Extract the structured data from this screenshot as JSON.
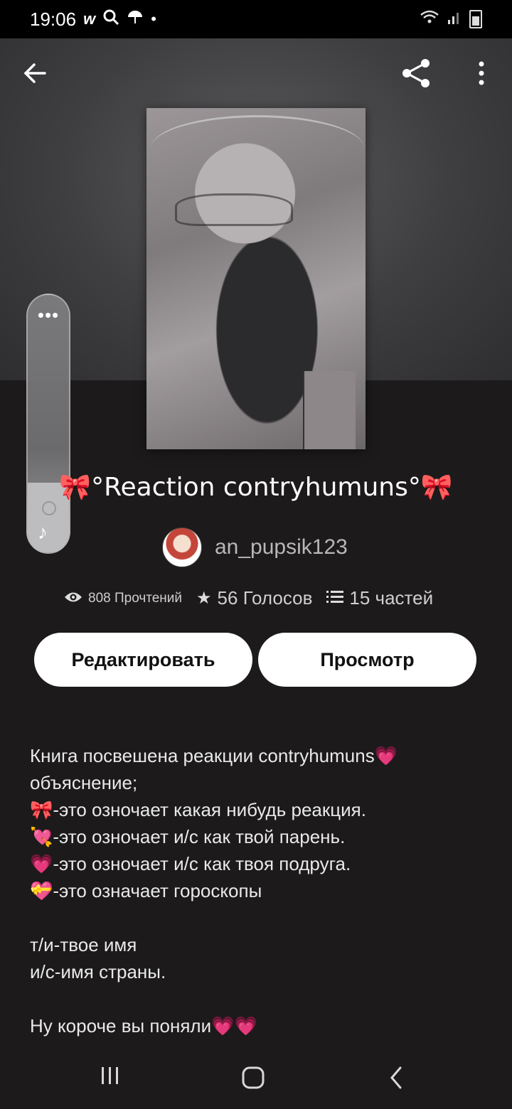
{
  "status_bar": {
    "time": "19:06",
    "icons": [
      "w-icon",
      "search-icon",
      "umbrella-icon",
      "dot-icon",
      "wifi-icon",
      "signal-icon",
      "battery-icon"
    ]
  },
  "top_bar": {
    "back_icon": "arrow-left-icon",
    "share_icon": "share-icon",
    "more_icon": "vertical-dots-icon"
  },
  "volume_panel": {
    "dots": "•••",
    "level": 0.27,
    "icon": "music-note-icon"
  },
  "story": {
    "title": "🎀°Reaction contryhumuns°🎀",
    "author": "an_pupsik123",
    "reads": "808 Прочтений",
    "votes": "56 Голосов",
    "parts": "15 частей"
  },
  "actions": {
    "edit_label": "Редактировать",
    "view_label": "Просмотр"
  },
  "description": {
    "lines": [
      "Книга посвешена реакции contryhumuns💗",
      "объяснение;",
      "🎀-это озночает какая нибудь реакция.",
      "💘-это озночает и/с как твой парень.",
      "💗-это озночает и/с как твоя подруга.",
      "💝-это означает гороскопы",
      "",
      "т/и-твое имя",
      "и/с-имя страны.",
      "",
      "Ну короче вы поняли💗💗"
    ]
  },
  "nav_bar": {
    "recent_icon": "recent-apps-icon",
    "home_icon": "home-icon",
    "back_icon": "back-chevron-icon"
  },
  "colors": {
    "background": "#1c1a1b",
    "button_bg": "#ffffff",
    "button_text": "#111111"
  }
}
